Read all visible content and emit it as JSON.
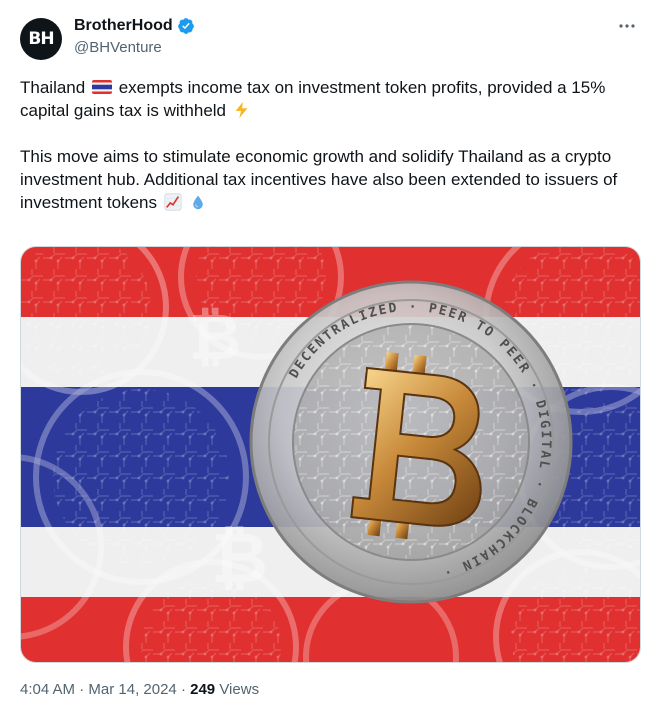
{
  "author": {
    "avatar_text": "BH",
    "display_name": "BrotherHood",
    "handle": "@BHVenture"
  },
  "tweet": {
    "line1_pre": "Thailand",
    "line1_post": "exempts income tax on investment token profits, provided a 15% capital gains tax is withheld",
    "paragraph2": "This move aims to stimulate economic growth and solidify Thailand as a crypto investment hub. Additional tax incentives have also been extended to issuers of investment tokens",
    "emojis": [
      "thailand-flag-emoji",
      "lightning-emoji",
      "chart-increasing-emoji",
      "droplet-emoji"
    ]
  },
  "media": {
    "coin_text": "DECENTRALIZED · PEER TO PEER · DIGITAL · BLOCKCHAIN ·",
    "flag_colors": [
      "#e0302f",
      "#f4f4f4",
      "#2d3a9c",
      "#f4f4f4",
      "#e0302f"
    ]
  },
  "meta": {
    "time": "4:04 AM",
    "sep1": "·",
    "date": "Mar 14, 2024",
    "sep2": "·",
    "views_count": "249",
    "views_label": "Views"
  },
  "colors": {
    "verified_blue": "#1d9bf0",
    "secondary_text": "#536471"
  }
}
